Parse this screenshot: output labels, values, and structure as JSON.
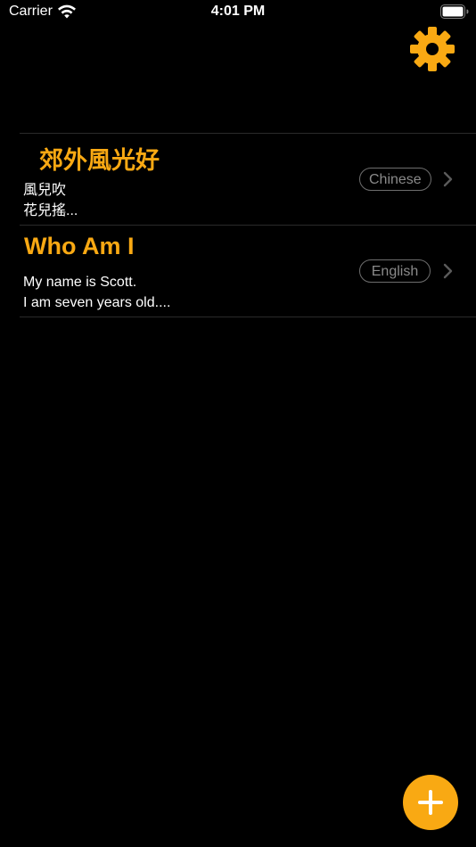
{
  "status_bar": {
    "carrier": "Carrier",
    "time": "4:01 PM",
    "wifi_icon": "wifi-icon",
    "battery_icon": "battery-icon"
  },
  "toolbar": {
    "settings_icon": "gear-icon"
  },
  "items": [
    {
      "title": "郊外風光好",
      "body": "風兒吹\n花兒搖...",
      "language": "Chinese"
    },
    {
      "title": "Who Am I",
      "body": "My name is Scott.\nI am seven years old....",
      "language": "English"
    }
  ],
  "fab": {
    "icon": "plus-icon"
  },
  "colors": {
    "accent": "#f9a913",
    "background": "#000000",
    "divider": "#2a2a2a",
    "badge_text": "#8a8a8a",
    "badge_border": "#6e6e6e"
  }
}
